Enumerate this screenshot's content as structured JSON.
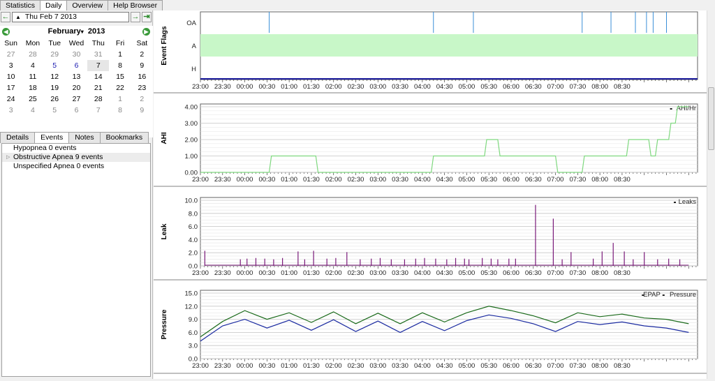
{
  "top_tabs": [
    {
      "label": "Statistics",
      "active": false
    },
    {
      "label": "Daily",
      "active": true
    },
    {
      "label": "Overview",
      "active": false
    },
    {
      "label": "Help Browser",
      "active": false
    }
  ],
  "date_bar": {
    "value": "Thu Feb 7 2013",
    "prev_icon": "arrow-left-icon",
    "next_icon": "arrow-right-icon",
    "last_icon": "arrow-last-icon"
  },
  "calendar": {
    "month": "February",
    "year": "2013",
    "days_of_week": [
      "Sun",
      "Mon",
      "Tue",
      "Wed",
      "Thu",
      "Fri",
      "Sat"
    ],
    "weeks": [
      [
        {
          "d": "27",
          "s": "dim"
        },
        {
          "d": "28",
          "s": "dim"
        },
        {
          "d": "29",
          "s": "dim"
        },
        {
          "d": "30",
          "s": "dim"
        },
        {
          "d": "31",
          "s": "dim"
        },
        {
          "d": "1",
          "s": ""
        },
        {
          "d": "2",
          "s": ""
        }
      ],
      [
        {
          "d": "3",
          "s": ""
        },
        {
          "d": "4",
          "s": ""
        },
        {
          "d": "5",
          "s": "blue"
        },
        {
          "d": "6",
          "s": "blue"
        },
        {
          "d": "7",
          "s": "sel"
        },
        {
          "d": "8",
          "s": ""
        },
        {
          "d": "9",
          "s": ""
        }
      ],
      [
        {
          "d": "10",
          "s": ""
        },
        {
          "d": "11",
          "s": ""
        },
        {
          "d": "12",
          "s": ""
        },
        {
          "d": "13",
          "s": ""
        },
        {
          "d": "14",
          "s": ""
        },
        {
          "d": "15",
          "s": ""
        },
        {
          "d": "16",
          "s": ""
        }
      ],
      [
        {
          "d": "17",
          "s": ""
        },
        {
          "d": "18",
          "s": ""
        },
        {
          "d": "19",
          "s": ""
        },
        {
          "d": "20",
          "s": ""
        },
        {
          "d": "21",
          "s": ""
        },
        {
          "d": "22",
          "s": ""
        },
        {
          "d": "23",
          "s": ""
        }
      ],
      [
        {
          "d": "24",
          "s": ""
        },
        {
          "d": "25",
          "s": ""
        },
        {
          "d": "26",
          "s": ""
        },
        {
          "d": "27",
          "s": ""
        },
        {
          "d": "28",
          "s": ""
        },
        {
          "d": "1",
          "s": "dim"
        },
        {
          "d": "2",
          "s": "dim"
        }
      ],
      [
        {
          "d": "3",
          "s": "dim"
        },
        {
          "d": "4",
          "s": "dim"
        },
        {
          "d": "5",
          "s": "dim"
        },
        {
          "d": "6",
          "s": "dim"
        },
        {
          "d": "7",
          "s": "dim"
        },
        {
          "d": "8",
          "s": "dim"
        },
        {
          "d": "9",
          "s": "dim"
        }
      ]
    ]
  },
  "sub_tabs": [
    {
      "label": "Details",
      "active": false
    },
    {
      "label": "Events",
      "active": true
    },
    {
      "label": "Notes",
      "active": false
    },
    {
      "label": "Bookmarks",
      "active": false
    }
  ],
  "events": [
    {
      "label": "Hypopnea 0 events",
      "expandable": false,
      "highlight": false
    },
    {
      "label": "Obstructive Apnea 9 events",
      "expandable": true,
      "highlight": true
    },
    {
      "label": "Unspecified Apnea 0 events",
      "expandable": false,
      "highlight": false
    }
  ],
  "time_ticks": [
    "23:00",
    "23:30",
    "00:00",
    "00:30",
    "01:00",
    "01:30",
    "02:00",
    "02:30",
    "03:00",
    "03:30",
    "04:00",
    "04:30",
    "05:00",
    "05:30",
    "06:00",
    "06:30",
    "07:00",
    "07:30",
    "08:00",
    "08:30"
  ],
  "colors": {
    "flags_band": "#c8f7c8",
    "oa_line": "#3a8fd8",
    "ahi": "#7fd87f",
    "leak": "#7a1a7a",
    "epap": "#1a2aa0",
    "pressure": "#1a6a1a"
  },
  "chart_data": [
    {
      "type": "scatter",
      "ylabel": "Event Flags",
      "categories": [
        "OA",
        "A",
        "H"
      ],
      "x_range_hours": [
        0,
        10.0
      ],
      "series": [
        {
          "name": "OA",
          "x": [
            1.55,
            5.25,
            6.15,
            8.6,
            9.25,
            9.8,
            10.05,
            10.2,
            10.5
          ]
        }
      ],
      "shaded_band": "A"
    },
    {
      "type": "line",
      "ylabel": "AHI",
      "ylim": [
        0,
        4
      ],
      "yticks": [
        "0.00",
        "1.00",
        "2.00",
        "3.00",
        "4.00"
      ],
      "legend": "top-right",
      "series": [
        {
          "name": "AHI/Hr",
          "x": [
            0,
            1.55,
            1.6,
            2.6,
            2.65,
            5.2,
            5.25,
            6.4,
            6.45,
            6.7,
            6.75,
            8.0,
            8.05,
            8.6,
            8.65,
            9.6,
            9.65,
            10.1,
            10.15,
            10.25,
            10.3,
            10.55,
            10.6,
            10.7,
            10.75,
            11.0
          ],
          "y": [
            0,
            0,
            1,
            1,
            0,
            0,
            1,
            1,
            2,
            2,
            1,
            1,
            0,
            0,
            1,
            1,
            2,
            2,
            1,
            1,
            2,
            2,
            3,
            3,
            4,
            4
          ]
        }
      ]
    },
    {
      "type": "bar",
      "ylabel": "Leak",
      "ylim": [
        0,
        10
      ],
      "yticks": [
        "0.0",
        "2.0",
        "4.0",
        "6.0",
        "8.0",
        "10.0"
      ],
      "legend": "top-right",
      "series": [
        {
          "name": "Leaks",
          "x": [
            0.1,
            0.9,
            1.05,
            1.25,
            1.45,
            1.65,
            1.85,
            2.2,
            2.35,
            2.55,
            2.85,
            3.05,
            3.3,
            3.6,
            3.85,
            4.05,
            4.3,
            4.6,
            4.85,
            5.05,
            5.3,
            5.55,
            5.75,
            5.95,
            6.05,
            6.35,
            6.55,
            6.7,
            6.95,
            7.1,
            7.55,
            7.95,
            8.15,
            8.35,
            8.85,
            9.05,
            9.3,
            9.55,
            9.75,
            10.0,
            10.3,
            10.55,
            10.8
          ],
          "y": [
            2.3,
            1.0,
            1.1,
            1.2,
            1.1,
            1.0,
            1.2,
            2.2,
            1.0,
            2.3,
            1.1,
            1.2,
            2.1,
            1.0,
            1.1,
            1.2,
            1.0,
            1.0,
            1.1,
            1.2,
            1.1,
            1.0,
            1.2,
            1.1,
            1.0,
            1.2,
            1.1,
            1.0,
            1.1,
            1.1,
            9.3,
            7.2,
            1.0,
            2.1,
            1.1,
            2.2,
            3.5,
            2.2,
            1.0,
            2.1,
            1.0,
            1.1,
            1.0
          ]
        }
      ]
    },
    {
      "type": "line",
      "ylabel": "Pressure",
      "ylim": [
        0,
        15
      ],
      "yticks": [
        "0.0",
        "3.0",
        "6.0",
        "9.0",
        "12.0",
        "15.0"
      ],
      "legend": "top-right",
      "series": [
        {
          "name": "EPAP",
          "x": [
            0,
            0.5,
            1.0,
            1.5,
            2.0,
            2.5,
            3.0,
            3.5,
            4.0,
            4.5,
            5.0,
            5.5,
            6.0,
            6.5,
            7.0,
            7.5,
            8.0,
            8.5,
            9.0,
            9.5,
            10.0,
            10.5,
            11.0
          ],
          "y": [
            4.0,
            7.5,
            9.0,
            7.0,
            8.8,
            6.5,
            8.9,
            6.2,
            8.6,
            6.0,
            8.5,
            6.4,
            8.7,
            10.0,
            9.2,
            8.0,
            6.2,
            8.5,
            7.8,
            8.4,
            7.5,
            7.0,
            6.0
          ]
        },
        {
          "name": "Pressure",
          "x": [
            0,
            0.5,
            1.0,
            1.5,
            2.0,
            2.5,
            3.0,
            3.5,
            4.0,
            4.5,
            5.0,
            5.5,
            6.0,
            6.5,
            7.0,
            7.5,
            8.0,
            8.5,
            9.0,
            9.5,
            10.0,
            10.5,
            11.0
          ],
          "y": [
            5.0,
            8.5,
            11.0,
            9.0,
            10.5,
            8.3,
            10.7,
            8.0,
            10.4,
            8.0,
            10.5,
            8.4,
            10.5,
            12.0,
            11.0,
            9.8,
            8.2,
            10.5,
            9.6,
            10.2,
            9.3,
            9.0,
            8.0
          ]
        }
      ]
    }
  ]
}
